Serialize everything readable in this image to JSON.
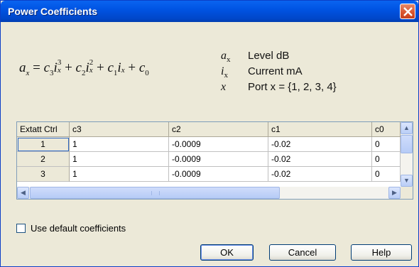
{
  "window": {
    "title": "Power Coefficients",
    "close_icon": "close-x-icon",
    "colors": {
      "titlebar": "#0054e3",
      "face": "#ece9d8",
      "close": "#d9532c"
    }
  },
  "formula": {
    "lhs": "a",
    "lhs_sub": "x",
    "equals": " = ",
    "terms": [
      {
        "coef": "c",
        "coef_sub": "3",
        "var": "i",
        "var_sub": "x",
        "exp": "3",
        "plus": " + "
      },
      {
        "coef": "c",
        "coef_sub": "2",
        "var": "i",
        "var_sub": "x",
        "exp": "2",
        "plus": " + "
      },
      {
        "coef": "c",
        "coef_sub": "1",
        "var": "i",
        "var_sub": "x",
        "exp": "",
        "plus": " + "
      },
      {
        "coef": "c",
        "coef_sub": "0",
        "var": "",
        "var_sub": "",
        "exp": "",
        "plus": ""
      }
    ]
  },
  "legend": [
    {
      "symbol": "a",
      "symbol_sub": "x",
      "text": "Level dB"
    },
    {
      "symbol": "i",
      "symbol_sub": "x",
      "text": "Current mA"
    },
    {
      "symbol": "x",
      "symbol_sub": "",
      "text": "Port x = {1, 2, 3, 4}"
    }
  ],
  "table": {
    "columns": [
      "Extatt Ctrl",
      "c3",
      "c2",
      "c1",
      "c0"
    ],
    "rows": [
      {
        "ctrl": "1",
        "c3": "1",
        "c2": "-0.0009",
        "c1": "-0.02",
        "c0": "0"
      },
      {
        "ctrl": "2",
        "c3": "1",
        "c2": "-0.0009",
        "c1": "-0.02",
        "c0": "0"
      },
      {
        "ctrl": "3",
        "c3": "1",
        "c2": "-0.0009",
        "c1": "-0.02",
        "c0": "0"
      }
    ],
    "scroll_icons": {
      "up": "arrow-up-icon",
      "down": "arrow-down-icon",
      "left": "arrow-left-icon",
      "right": "arrow-right-icon"
    }
  },
  "options": {
    "use_default_label": "Use default coefficients",
    "use_default_checked": false
  },
  "buttons": {
    "ok": "OK",
    "cancel": "Cancel",
    "help": "Help"
  }
}
